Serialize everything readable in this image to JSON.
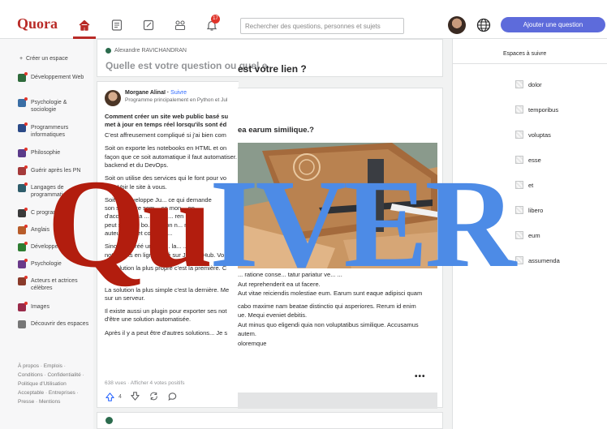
{
  "app": {
    "logo": "Quora"
  },
  "topbar": {
    "search_placeholder": "Rechercher des questions, personnes et sujets",
    "notifications_count": "17",
    "ask_button": "Ajouter une question",
    "nav_icons": [
      "home-icon",
      "answers-icon",
      "write-icon",
      "spaces-icon",
      "bell-icon"
    ]
  },
  "sidebar": {
    "create_space": "Créer un espace",
    "items": [
      {
        "label": "Développement Web",
        "color": "#2f6b3c"
      },
      {
        "label": "Psychologie & sociologie",
        "color": "#3a6ea5"
      },
      {
        "label": "Programmeurs informatiques",
        "color": "#2b4a88"
      },
      {
        "label": "Philosophie",
        "color": "#5b3b8a"
      },
      {
        "label": "Guérir après les PN",
        "color": "#a53a3a"
      },
      {
        "label": "Langages de programmation",
        "color": "#2f5d6b"
      },
      {
        "label": "C programming",
        "color": "#3a3a3a"
      },
      {
        "label": "Anglais",
        "color": "#b85c2a"
      },
      {
        "label": "Développement",
        "color": "#2e7d32"
      },
      {
        "label": "Psychologie",
        "color": "#6a3a8a"
      },
      {
        "label": "Acteurs et actrices célèbres",
        "color": "#8a3a2a"
      },
      {
        "label": "Images",
        "color": "#9a2a4a"
      },
      {
        "label": "Découvrir des espaces",
        "color": "#777777"
      }
    ],
    "footer": "À propos · Emplois · Conditions · Confidentialité · Politique d'Utilisation Acceptable · Entreprises · Presse · Mentions"
  },
  "ask_box": {
    "user": "Alexandre RAVICHANDRAN",
    "prompt": "Quelle est votre question ou quel e",
    "prompt_overlay": "est votre lien ?"
  },
  "post_left": {
    "author": "Morgane Alinaï",
    "follow": "Suivre",
    "credential": "Programme principalement en Python et Jul",
    "title_lines": [
      "Comment créer un site web public basé su",
      "met à jour en temps réel lorsqu'ils sont éd"
    ],
    "body_lines": [
      "C'est affreusement compliqué si j'ai bien com",
      "",
      "Soit on exporte les notebooks en HTML et on",
      "façon que ce soit automatique il faut automatiser. C",
      "backend et du DevOps.",
      "",
      "Soit on utilise des services qui le font pour vo",
      "site. Voir le site à vous.",
      "",
      "Soit on développe Ju... ce qui demande",
      "son site ...ure sem... ce mon... on",
      "d'accu... ra va ... Ens... ... ren",
      "peut s'... une bo... olution n... nse",
      "auteur ... er et co... cter...",
      "",
      "Sino... se créé un site ... la... ... ...",
      "notebooks en ligne basé sur JupyterHub. Vol",
      "",
      "La solution la plus propre c'est la première. C",
      "réactif.",
      "",
      "La solution la plus simple c'est la dernière. Me",
      "sur un serveur.",
      "",
      "Il existe aussi un plugin pour exporter ses not",
      "d'être une solution automatisée.",
      "",
      "Après il y a peut être d'autres solutions... Je s"
    ],
    "stats": "638 vues · Afficher 4 votes positifs",
    "upvotes": "4"
  },
  "post_right": {
    "title": "ea earum similique.?",
    "body_lines": [
      "... ratione conse... tatur pariatur ve... ...",
      "Aut reprehenderit ea ut facere.",
      "Aut vitae reiciendis molestiae eum. Earum sunt eaque adipisci quam",
      "",
      "cabo maxime nam beatae distinctio qui asperiores. Rerum id enim",
      "ue. Mequi eveniet debitis.",
      "Aut minus quo eligendi quia non voluptatibus similique. Accusamus",
      "autem.",
      "oloremque"
    ],
    "more": "•••"
  },
  "right_sidebar": {
    "title": "Espaces à suivre",
    "spaces": [
      "dolor",
      "temporibus",
      "voluptas",
      "esse",
      "et",
      "libero",
      "eum",
      "assumenda"
    ]
  },
  "watermark": {
    "part1": "Qu",
    "part2": "IVER"
  },
  "colors": {
    "brand": "#b92b27",
    "accent": "#5d6bdb",
    "link": "#2e69ff"
  }
}
